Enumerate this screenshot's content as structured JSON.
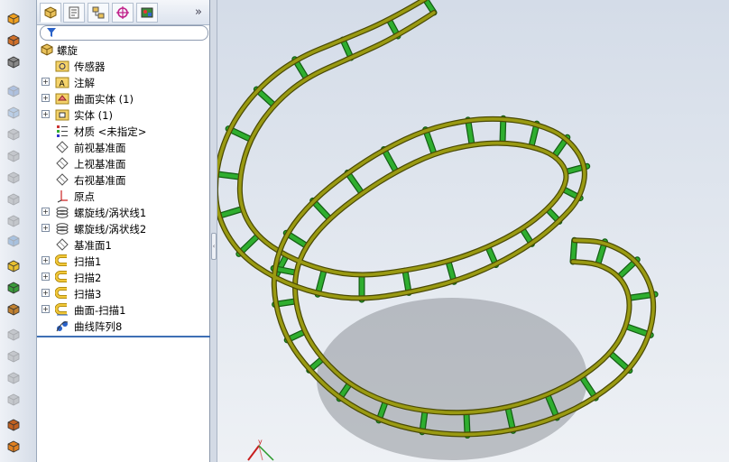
{
  "command_strip": {
    "buttons": [
      {
        "icon": "extruded-boss-icon"
      },
      {
        "icon": "revolved-boss-icon"
      },
      {
        "icon": "swept-boss-icon"
      },
      {
        "icon": "lofted-boss-icon"
      },
      {
        "icon": "boundary-boss-icon"
      },
      {
        "icon": "extruded-cut-icon"
      },
      {
        "icon": "revolved-cut-icon"
      },
      {
        "icon": "swept-cut-icon"
      },
      {
        "icon": "lofted-cut-icon"
      },
      {
        "icon": "boundary-cut-icon"
      },
      {
        "icon": "hole-wizard-icon"
      },
      {
        "icon": "fillet-icon"
      },
      {
        "icon": "linear-pattern-icon"
      },
      {
        "icon": "rib-icon"
      },
      {
        "icon": "draft-icon"
      },
      {
        "icon": "shell-icon"
      },
      {
        "icon": "wrap-icon"
      },
      {
        "icon": "intersect-icon"
      },
      {
        "icon": "mirror-icon"
      },
      {
        "icon": "reference-geometry-icon"
      },
      {
        "icon": "curves-icon"
      }
    ]
  },
  "feature_manager": {
    "tabs": [
      {
        "name": "featuremanager-tab",
        "active": true
      },
      {
        "name": "propertymanager-tab",
        "active": false
      },
      {
        "name": "configurationmanager-tab",
        "active": false
      },
      {
        "name": "dimxpert-tab",
        "active": false
      },
      {
        "name": "display-manager-tab",
        "active": false
      }
    ],
    "more_glyph": "»",
    "tree": [
      {
        "label": "螺旋",
        "icon": "part-icon",
        "expandable": false,
        "level": 0
      },
      {
        "label": "传感器",
        "icon": "sensor-folder-icon",
        "expandable": false,
        "level": 1
      },
      {
        "label": "注解",
        "icon": "annotations-icon",
        "expandable": true,
        "level": 1
      },
      {
        "label": "曲面实体 (1)",
        "icon": "surface-bodies-icon",
        "expandable": true,
        "level": 1
      },
      {
        "label": "实体 (1)",
        "icon": "solid-bodies-icon",
        "expandable": true,
        "level": 1
      },
      {
        "label": "材质 <未指定>",
        "icon": "material-icon",
        "expandable": false,
        "level": 1
      },
      {
        "label": "前视基准面",
        "icon": "plane-icon",
        "expandable": false,
        "level": 1
      },
      {
        "label": "上视基准面",
        "icon": "plane-icon",
        "expandable": false,
        "level": 1
      },
      {
        "label": "右视基准面",
        "icon": "plane-icon",
        "expandable": false,
        "level": 1
      },
      {
        "label": "原点",
        "icon": "origin-icon",
        "expandable": false,
        "level": 1
      },
      {
        "label": "螺旋线/涡状线1",
        "icon": "helix-icon",
        "expandable": true,
        "level": 1
      },
      {
        "label": "螺旋线/涡状线2",
        "icon": "helix-icon",
        "expandable": true,
        "level": 1
      },
      {
        "label": "基准面1",
        "icon": "plane-icon",
        "expandable": false,
        "level": 1
      },
      {
        "label": "扫描1",
        "icon": "sweep-icon",
        "expandable": true,
        "level": 1
      },
      {
        "label": "扫描2",
        "icon": "sweep-icon",
        "expandable": true,
        "level": 1
      },
      {
        "label": "扫描3",
        "icon": "sweep-icon",
        "expandable": true,
        "level": 1
      },
      {
        "label": "曲面-扫描1",
        "icon": "surface-sweep-icon",
        "expandable": true,
        "level": 1
      },
      {
        "label": "曲线阵列8",
        "icon": "curve-pattern-icon",
        "expandable": false,
        "level": 1
      }
    ]
  },
  "viewport": {
    "rail_color": "#9a9a12",
    "rung_color": "#2fae2f",
    "triad_axis": "y"
  }
}
